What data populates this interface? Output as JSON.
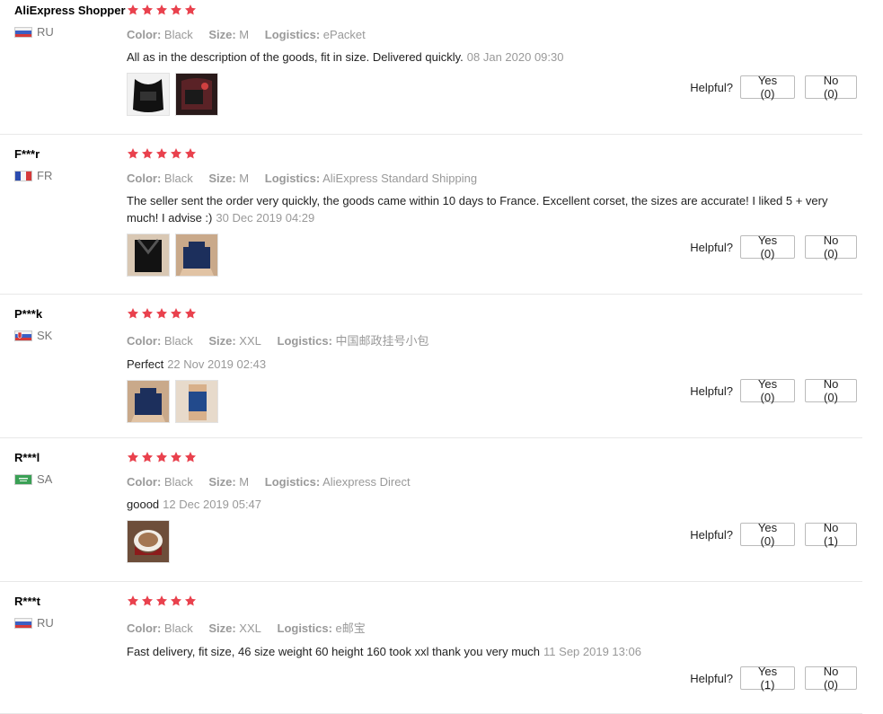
{
  "labels": {
    "color": "Color:",
    "size": "Size:",
    "logistics": "Logistics:",
    "helpful": "Helpful?"
  },
  "star_color": "#e9414d",
  "reviews": [
    {
      "user": "AliExpress Shopper",
      "country": "RU",
      "flag": "russia-flag",
      "rating": 5,
      "color": "Black",
      "size": "M",
      "logistics": "ePacket",
      "text": "All as in the description of the goods, fit in size. Delivered quickly.",
      "date": "08 Jan 2020 09:30",
      "images": [
        "posture-corrector-photo",
        "package-photo"
      ],
      "yes": "Yes (0)",
      "no": "No (0)"
    },
    {
      "user": "F***r",
      "country": "FR",
      "flag": "france-flag",
      "rating": 5,
      "color": "Black",
      "size": "M",
      "logistics": "AliExpress Standard Shipping",
      "text": "The seller sent the order very quickly, the goods came within 10 days to France. Excellent corset, the sizes are accurate! I liked 5 + very much! I advise :)",
      "date": "30 Dec 2019 04:29",
      "images": [
        "corset-back-photo",
        "corset-worn-photo"
      ],
      "yes": "Yes (0)",
      "no": "No (0)"
    },
    {
      "user": "P***k",
      "country": "SK",
      "flag": "slovakia-flag",
      "rating": 5,
      "color": "Black",
      "size": "XXL",
      "logistics": "中国邮政挂号小包",
      "text": "Perfect",
      "date": "22 Nov 2019 02:43",
      "images": [
        "corset-worn-photo",
        "corset-side-photo"
      ],
      "yes": "Yes (0)",
      "no": "No (0)"
    },
    {
      "user": "R***l",
      "country": "SA",
      "flag": "saudi-flag",
      "rating": 5,
      "color": "Black",
      "size": "M",
      "logistics": "Aliexpress Direct",
      "text": "goood",
      "date": "12 Dec 2019 05:47",
      "images": [
        "coffee-cup-photo"
      ],
      "yes": "Yes (0)",
      "no": "No (1)"
    },
    {
      "user": "R***t",
      "country": "RU",
      "flag": "russia-flag",
      "rating": 5,
      "color": "Black",
      "size": "XXL",
      "logistics": "e邮宝",
      "text": "Fast delivery, fit size, 46 size weight 60 height 160 took xxl thank you very much",
      "date": "11 Sep 2019 13:06",
      "images": [],
      "yes": "Yes (1)",
      "no": "No (0)"
    }
  ]
}
